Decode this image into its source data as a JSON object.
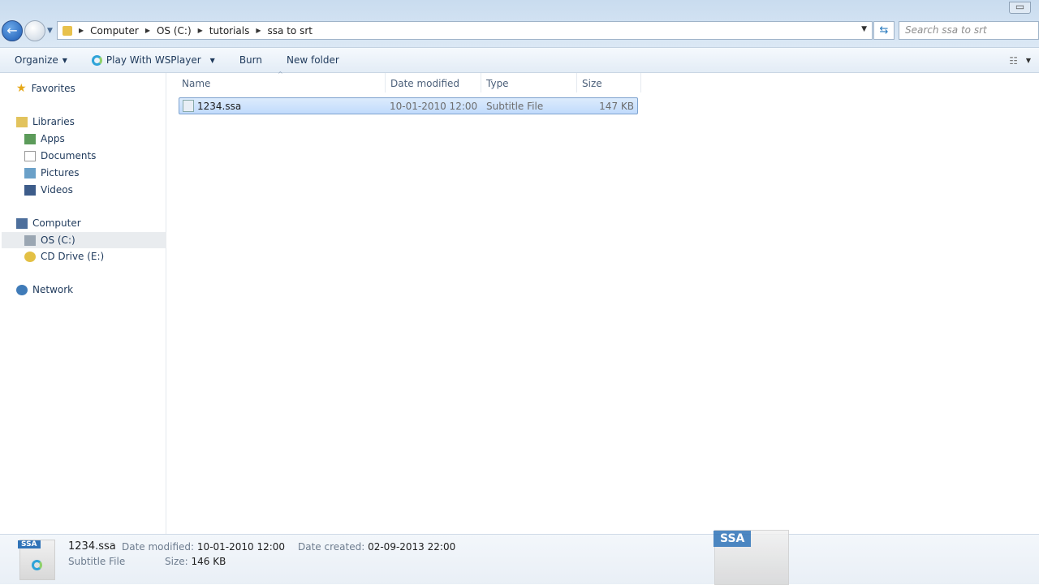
{
  "address": {
    "crumbs": [
      "Computer",
      "OS (C:)",
      "tutorials",
      "ssa to srt"
    ],
    "search_placeholder": "Search ssa to srt"
  },
  "toolbar": {
    "organize": "Organize",
    "play": "Play With WSPlayer",
    "burn": "Burn",
    "new_folder": "New folder"
  },
  "sidebar": {
    "favorites": "Favorites",
    "libraries": "Libraries",
    "apps": "Apps",
    "documents": "Documents",
    "pictures": "Pictures",
    "videos": "Videos",
    "computer": "Computer",
    "os": "OS (C:)",
    "cd": "CD Drive (E:)",
    "network": "Network"
  },
  "columns": {
    "name": "Name",
    "date": "Date modified",
    "type": "Type",
    "size": "Size"
  },
  "files": [
    {
      "name": "1234.ssa",
      "date": "10-01-2010 12:00",
      "type": "Subtitle File",
      "size": "147 KB"
    }
  ],
  "details": {
    "icon_label": "SSA",
    "name": "1234.ssa",
    "type": "Subtitle File",
    "date_modified_label": "Date modified:",
    "date_modified": "10-01-2010 12:00",
    "size_label": "Size:",
    "size": "146 KB",
    "date_created_label": "Date created:",
    "date_created": "02-09-2013 22:00"
  },
  "drag_icon_label": "SSA"
}
